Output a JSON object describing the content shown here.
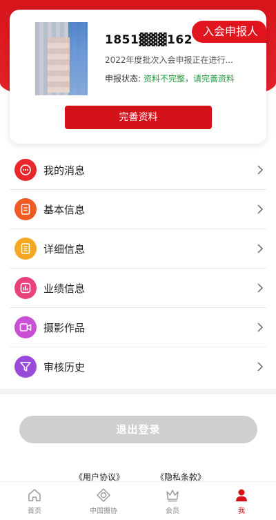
{
  "profile": {
    "phone": "1851▓▓▓162",
    "role_badge": "入会申报人",
    "batch_text": "2022年度批次入会申报正在进行...",
    "status_label": "申报状态:",
    "status_value": "资料不完整，请完善资料",
    "complete_button": "完善资料"
  },
  "menu": {
    "items": [
      {
        "label": "我的消息",
        "icon": "message-icon",
        "color": "#e8262b"
      },
      {
        "label": "基本信息",
        "icon": "document-icon",
        "color": "#f05a23"
      },
      {
        "label": "详细信息",
        "icon": "list-doc-icon",
        "color": "#f5a623"
      },
      {
        "label": "业绩信息",
        "icon": "chart-icon",
        "color": "#e8417c"
      },
      {
        "label": "摄影作品",
        "icon": "video-icon",
        "color": "#c84fd6"
      },
      {
        "label": "审核历史",
        "icon": "filter-icon",
        "color": "#9a4ad8"
      }
    ]
  },
  "logout_label": "退出登录",
  "links": {
    "user_agreement": "《用户协议》",
    "privacy": "《隐私条款》"
  },
  "tabbar": {
    "tabs": [
      {
        "label": "首页",
        "icon": "home-icon"
      },
      {
        "label": "中国摄协",
        "icon": "association-icon"
      },
      {
        "label": "会员",
        "icon": "crown-icon"
      },
      {
        "label": "我",
        "icon": "person-icon"
      }
    ],
    "active_index": 3
  },
  "colors": {
    "brand_red": "#d3121a",
    "status_green": "#1f9a3c"
  }
}
